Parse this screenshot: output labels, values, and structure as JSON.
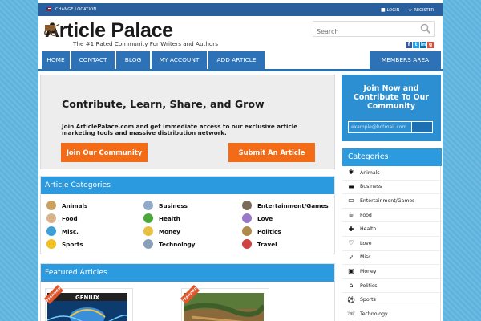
{
  "topbar": {
    "change_location": "CHANGE LOCATION",
    "login": "LOGIN",
    "register": "REGISTER"
  },
  "header": {
    "logo": "Article Palace",
    "tagline": "The #1 Rated Community For Writers and Authors",
    "search_placeholder": "Search",
    "social": [
      "facebook-icon",
      "twitter-icon",
      "linkedin-icon",
      "googleplus-icon"
    ]
  },
  "nav": {
    "items": [
      "HOME",
      "CONTACT",
      "BLOG",
      "MY ACCOUNT",
      "ADD ARTICLE"
    ],
    "members": "MEMBERS AREA"
  },
  "hero": {
    "title": "Contribute, Learn, Share, and Grow",
    "text": "Join ArticlePalace.com and get immediate access to our exclusive article marketing tools and massive distribution network.",
    "join_button": "Join Our Community",
    "submit_button": "Submit An Article"
  },
  "categories": {
    "title": "Article Categories",
    "items": [
      {
        "label": "Animals",
        "icon": "animals-icon",
        "color": "#c8a060"
      },
      {
        "label": "Business",
        "icon": "business-icon",
        "color": "#8fa9c8"
      },
      {
        "label": "Entertainment/Games",
        "icon": "entertainment-icon",
        "color": "#7a6a58"
      },
      {
        "label": "Food",
        "icon": "food-icon",
        "color": "#d9b48a"
      },
      {
        "label": "Health",
        "icon": "health-icon",
        "color": "#4aa838"
      },
      {
        "label": "Love",
        "icon": "love-icon",
        "color": "#9a7ac8"
      },
      {
        "label": "Misc.",
        "icon": "misc-icon",
        "color": "#3f9fd8"
      },
      {
        "label": "Money",
        "icon": "money-icon",
        "color": "#e8c040"
      },
      {
        "label": "Politics",
        "icon": "politics-icon",
        "color": "#b08a4a"
      },
      {
        "label": "Sports",
        "icon": "sports-icon",
        "color": "#f0c020"
      },
      {
        "label": "Technology",
        "icon": "technology-icon",
        "color": "#8aa0b8"
      },
      {
        "label": "Travel",
        "icon": "travel-icon",
        "color": "#d04040"
      }
    ]
  },
  "featured": {
    "title": "Featured Articles",
    "ribbon": "FEATURED",
    "thumbs": [
      {
        "caption": "GENIUX"
      },
      {
        "caption": ""
      }
    ]
  },
  "join_box": {
    "title": "Join Now and Contribute To Our Community",
    "email_placeholder": "example@hotmail.com"
  },
  "sidebar": {
    "title": "Categories",
    "items": [
      {
        "label": "Animals",
        "icon": "paw-icon",
        "glyph": "✱"
      },
      {
        "label": "Business",
        "icon": "briefcase-icon",
        "glyph": "▬"
      },
      {
        "label": "Entertainment/Games",
        "icon": "gamepad-icon",
        "glyph": "▭"
      },
      {
        "label": "Food",
        "icon": "coffee-icon",
        "glyph": "☕"
      },
      {
        "label": "Health",
        "icon": "medkit-icon",
        "glyph": "✚"
      },
      {
        "label": "Love",
        "icon": "heart-icon",
        "glyph": "♡"
      },
      {
        "label": "Misc.",
        "icon": "rocket-icon",
        "glyph": "➹"
      },
      {
        "label": "Money",
        "icon": "money-icon",
        "glyph": "▣"
      },
      {
        "label": "Politics",
        "icon": "institution-icon",
        "glyph": "⌂"
      },
      {
        "label": "Sports",
        "icon": "soccer-ball-icon",
        "glyph": "⚽"
      },
      {
        "label": "Technology",
        "icon": "phone-icon",
        "glyph": "☏"
      }
    ]
  },
  "colors": {
    "accent_blue": "#2b9ade",
    "nav_blue": "#2d72b6",
    "orange": "#f46b17"
  }
}
